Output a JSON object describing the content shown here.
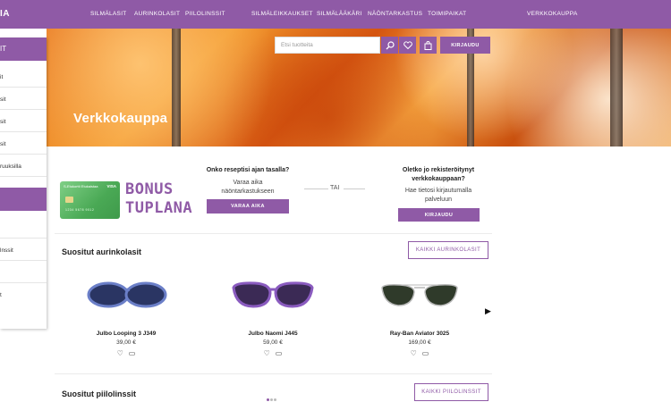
{
  "brand": {
    "logo_text": "IA",
    "accent": "#8f5aa6"
  },
  "nav": {
    "links": [
      "SILMÄLASIT",
      "AURINKOLASIT",
      "PIILOLINSSIT",
      "SILMÄLEIKKAUKSET",
      "SILMÄLÄÄKÄRI",
      "NÄÖNTARKASTUS",
      "TOIMIPAIKAT",
      "VERKKOKAUPPA"
    ]
  },
  "hero": {
    "title": "Verkkokauppa",
    "search_placeholder": "Etsi tuotteita",
    "login_label": "KIRJAUDU"
  },
  "sidebar": {
    "head1": "IT",
    "items1": [
      "it",
      "sit",
      "sit",
      "sit",
      "ruuksilla"
    ],
    "items2": [
      "",
      "lnssit",
      "",
      "t"
    ]
  },
  "promo": {
    "card_label": "S-Etukortti Etukaistaa",
    "card_visa": "VISA",
    "card_number": "1234 5678 9012",
    "bonus_line1": "BONUS",
    "bonus_line2": "TUPLANA",
    "question1": "Onko reseptisi ajan tasalla?",
    "text1": "Varaa aika näöntarkastukseen",
    "button1": "VARAA AIKA",
    "or_text": "TAI",
    "question2": "Oletko jo rekisteröitynyt verkkokauppaan?",
    "text2": "Hae tietosi kirjautumalla palveluun",
    "button2": "KIRJAUDU"
  },
  "sunglasses_section": {
    "title": "Suositut aurinkolasit",
    "button": "KAIKKI AURINKOLASIT",
    "products": [
      {
        "name": "Julbo Looping 3 J349",
        "price": "39,00 €",
        "frame_color": "#6b7fc8",
        "lens_color": "#2a3563"
      },
      {
        "name": "Julbo Naomi J445",
        "price": "59,00 €",
        "frame_color": "#8a5bbf",
        "lens_color": "#3b2a55"
      },
      {
        "name": "Ray-Ban Aviator 3025",
        "price": "169,00 €",
        "frame_color": "#b9b9b9",
        "lens_color": "#2f3a2a"
      }
    ]
  },
  "contacts_section": {
    "title": "Suositut piilolinssit",
    "button": "KAIKKI PIILOLINSSIT"
  },
  "icons": {
    "search": "search-icon",
    "heart": "heart-icon",
    "cart": "cart-icon",
    "next": "chevron-right-icon"
  }
}
